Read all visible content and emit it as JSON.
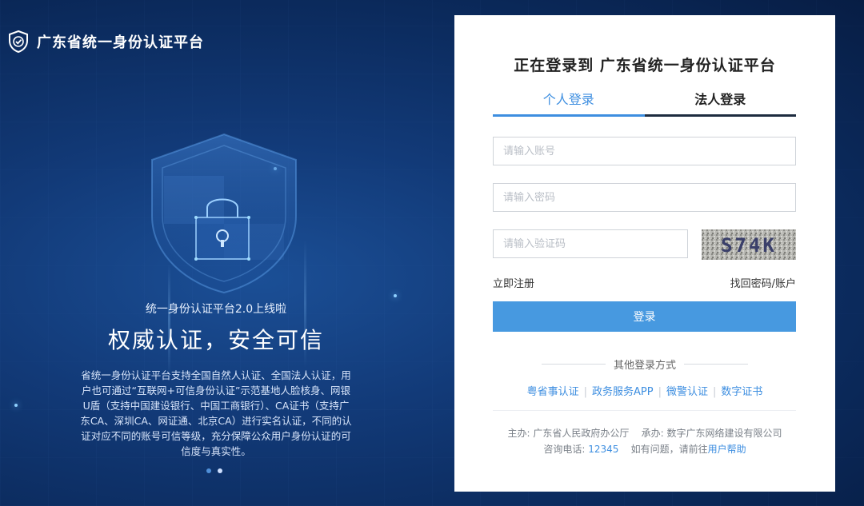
{
  "brand": {
    "title": "广东省统一身份认证平台"
  },
  "promo": {
    "subtitle": "统一身份认证平台2.0上线啦",
    "title": "权威认证，安全可信",
    "description": "省统一身份认证平台支持全国自然人认证、全国法人认证，用户也可通过“互联网+可信身份认证”示范基地人脸核身、网银U盾（支持中国建设银行、中国工商银行）、CA证书（支持广东CA、深圳CA、网证通、北京CA）进行实名认证，不同的认证对应不同的账号可信等级，充分保障公众用户身份认证的可信度与真实性。"
  },
  "login": {
    "title": "正在登录到 广东省统一身份认证平台",
    "tabs": [
      {
        "label": "个人登录"
      },
      {
        "label": "法人登录"
      }
    ],
    "account_placeholder": "请输入账号",
    "password_placeholder": "请输入密码",
    "captcha_placeholder": "请输入验证码",
    "captcha_text": "S74K",
    "register_label": "立即注册",
    "recover_label": "找回密码/账户",
    "submit_label": "登录",
    "other_methods_label": "其他登录方式",
    "other_methods": [
      "粤省事认证",
      "政务服务APP",
      "微警认证",
      "数字证书"
    ],
    "footer": {
      "host": "主办: 广东省人民政府办公厅",
      "operator": "承办: 数字广东网络建设有限公司",
      "phone_label": "咨询电话:",
      "phone": "12345",
      "help_text": "如有问题，请前往",
      "help_link": "用户帮助"
    }
  },
  "colors": {
    "accent": "#4799e0",
    "tab_active": "#3d8ee0",
    "background": "#0b2a5c"
  }
}
